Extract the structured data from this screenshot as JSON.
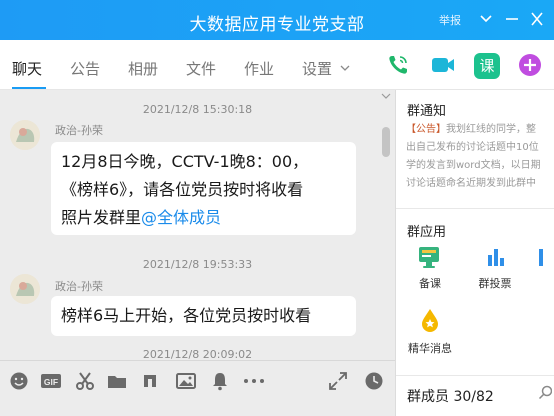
{
  "window": {
    "title": "大数据应用专业党支部",
    "report": "举报"
  },
  "tabs": [
    {
      "label": "聊天"
    },
    {
      "label": "公告"
    },
    {
      "label": "相册"
    },
    {
      "label": "文件"
    },
    {
      "label": "作业"
    },
    {
      "label": "设置"
    }
  ],
  "actions": {
    "course_label": "课"
  },
  "messages": [
    {
      "time": "2021/12/8 15:30:18",
      "sender": "政治-孙荣",
      "line1": "12月8日今晚，CCTV-1晚8：00，",
      "line2": "《榜样6》，请各位党员按时将收看",
      "line3": "照片发群里",
      "mention": "@全体成员"
    },
    {
      "time": "2021/12/8 19:53:33",
      "sender": "政治-孙荣",
      "text": "榜样6马上开始，各位党员按时收看"
    },
    {
      "time": "2021/12/8 20:09:02"
    }
  ],
  "panel": {
    "notice_title": "群通知",
    "notice_tag": "【公告】",
    "notice_lines": [
      "我划红线的同学，整",
      "出自己发布的讨论话题中10位",
      "学的发言到word文档，以日期",
      "讨论话题命名近期发到此群中"
    ],
    "apps_title": "群应用",
    "apps": [
      {
        "label": "备课"
      },
      {
        "label": "群投票"
      },
      {
        "label": ""
      },
      {
        "label": "精华消息"
      }
    ],
    "members": "群成员 30/82"
  },
  "colors": {
    "brand": "#1a9cf4",
    "call_green": "#1fb76b",
    "video_cyan": "#1cb6d8",
    "magic_purple": "#c04de0"
  }
}
